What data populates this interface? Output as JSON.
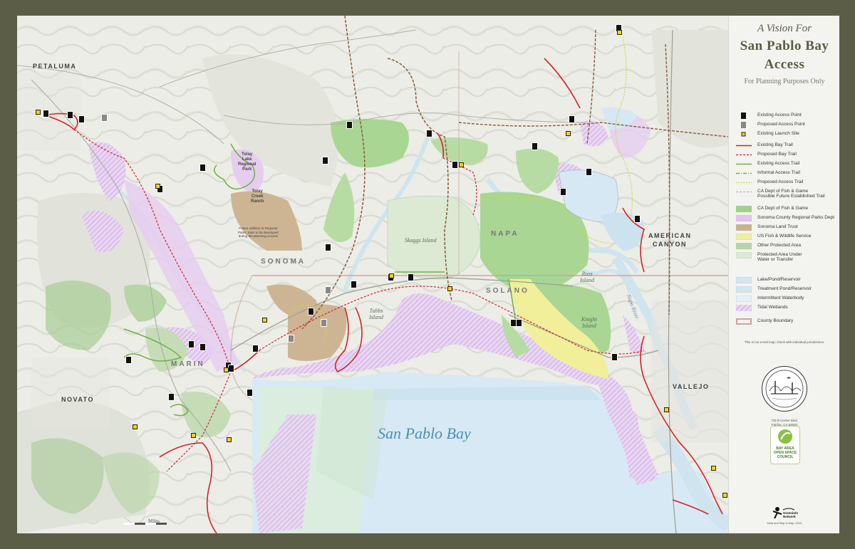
{
  "title": {
    "line1": "A Vision For",
    "line2": "San Pablo Bay",
    "line3": "Access",
    "subtitle": "For Planning Purposes Only"
  },
  "legend": {
    "items": [
      {
        "label": "Existing Access Point",
        "symbol": "existing-access-point-icon"
      },
      {
        "label": "Proposed Access Point",
        "symbol": "proposed-access-point-icon"
      },
      {
        "label": "Existing Launch Site",
        "symbol": "launch-site-icon"
      },
      {
        "label": "Existing Bay Trail",
        "color": "#d3232a",
        "style": "solid"
      },
      {
        "label": "Proposed Bay Trail",
        "color": "#d3232a",
        "style": "dashed"
      },
      {
        "label": "Existing Access Trail",
        "color": "#6cb33f",
        "style": "solid"
      },
      {
        "label": "Informal Access Trail",
        "color": "#6cb33f",
        "style": "dash-dot"
      },
      {
        "label": "Proposed Access Trail",
        "color": "#c8d83a",
        "style": "dotted"
      },
      {
        "label": "CA Dept of Fish & Game\nPossible Future Established Trail",
        "color": "#c9a3d8",
        "style": "dashed"
      },
      {
        "label": "CA Dept of Fish & Game",
        "color": "#9fd38a",
        "style": "fill"
      },
      {
        "label": "Sonoma County Regional Parks Dept",
        "color": "#e3c4ee",
        "style": "fill"
      },
      {
        "label": "Sonoma Land Trust",
        "color": "#c9b08f",
        "style": "fill"
      },
      {
        "label": "US Fish & Wildlife Service",
        "color": "#f1ef9a",
        "style": "fill"
      },
      {
        "label": "Other Protected Area",
        "color": "#b7d4a8",
        "style": "fill"
      },
      {
        "label": "Protected Area Under\nWater or Transfer",
        "color": "#dcead4",
        "style": "fill"
      },
      {
        "label": "Lake/Pond/Reservoir",
        "color": "#cfe6f5",
        "style": "fill"
      },
      {
        "label": "Treatment Pond/Reservoir",
        "color": "#cfe6f5",
        "style": "fill"
      },
      {
        "label": "Intermittent Waterbody",
        "color": "#e6f0f7",
        "style": "fill"
      },
      {
        "label": "Tidal Wetlands",
        "color": "#d8b6ea",
        "style": "hatch"
      },
      {
        "label": "County Boundary",
        "color": "#caa6a0",
        "style": "boundary"
      }
    ],
    "note": "This is not a trail map; check with individual jurisdictions.",
    "jv_logo_text": "SAN FRANCISCO BAY JOINT VENTURE",
    "jv_caption": "735 B Center Blvd.\nFairfax, CA 94930\n415-259-0334\nwww.sfbayjv.org",
    "osc_logo_text": "BAY AREA\nOPEN SPACE\nCOUNCIL",
    "gn_logo_text": "Greeninfo\nNetwork",
    "gn_caption": "Data and Map & Map: 2010"
  },
  "map": {
    "bay_label": "San Pablo Bay",
    "counties": [
      "SONOMA",
      "MARIN",
      "NAPA",
      "SOLANO"
    ],
    "places": [
      "PETALUMA",
      "NOVATO",
      "AMERICAN",
      "CANYON",
      "VALLEJO"
    ],
    "water_labels": [
      "Skaggs Island",
      "Tubbs\nIsland",
      "Russ\nIsland",
      "Knight\nIsland",
      "Napa River"
    ],
    "parks": [
      "Tolay\nLake\nRegional\nPark",
      "Tolay\nCreek\nRanch"
    ],
    "park_note": "Future addition to Regional\nParks; trails to be developed\nduring the planning process",
    "scale": "Miles"
  }
}
